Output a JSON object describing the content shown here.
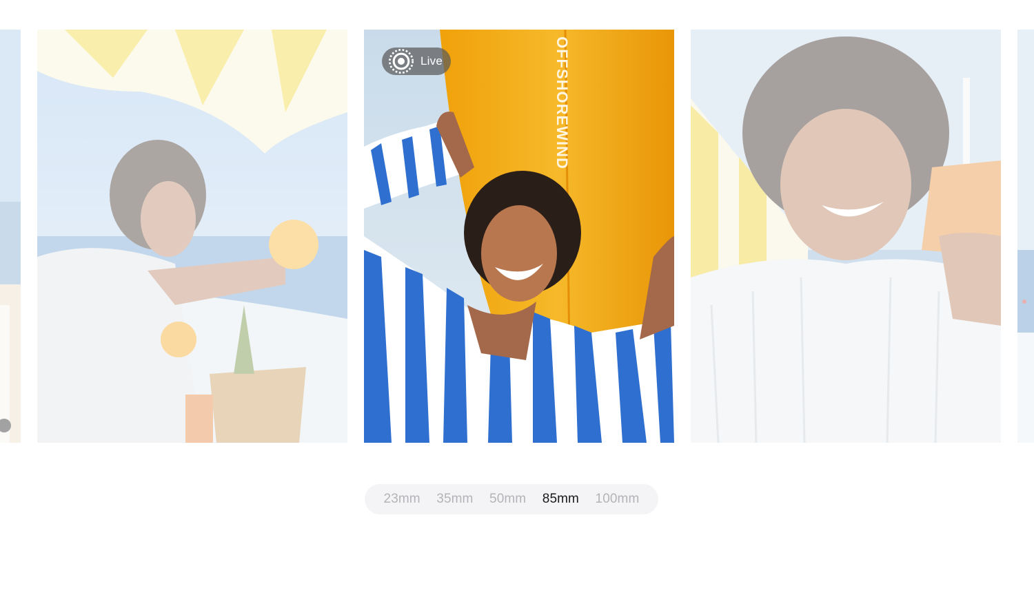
{
  "gallery": {
    "live_badge_label": "Live",
    "focal_options": [
      "23mm",
      "35mm",
      "50mm",
      "85mm",
      "100mm"
    ],
    "selected_focal": "85mm"
  },
  "colors": {
    "sky": "#b9d3ec",
    "surfboard": "#f2a80f",
    "shirt_blue": "#2f6fcf",
    "bar_background": "#f4f4f6",
    "option_inactive": "#b4b4b8",
    "option_active": "#1a1a1a"
  },
  "icons": {
    "live": "live-photo-icon"
  }
}
